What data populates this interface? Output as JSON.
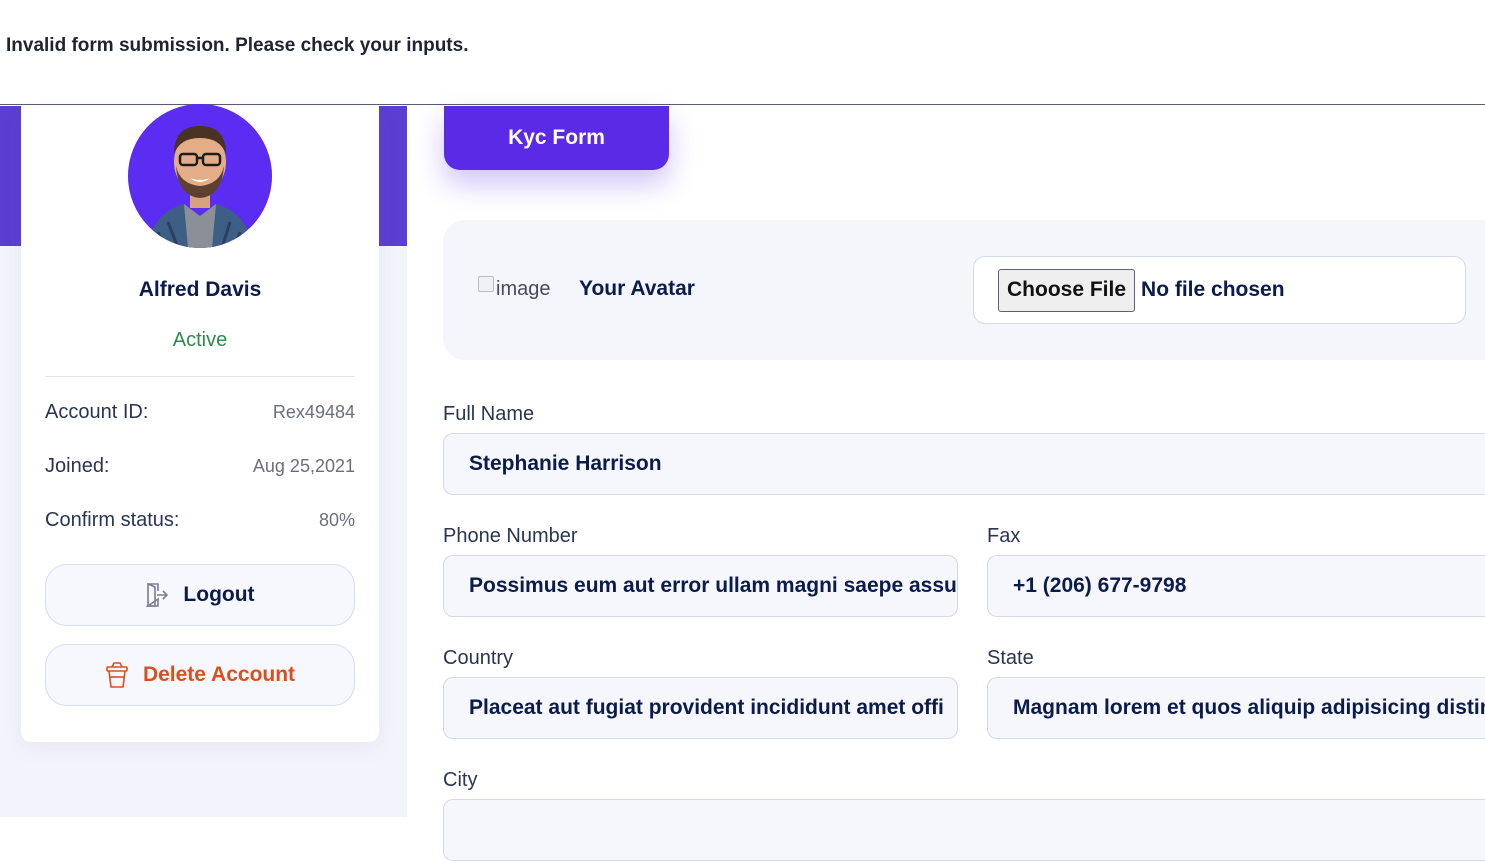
{
  "alert": {
    "message": "Invalid form submission. Please check your inputs."
  },
  "profile": {
    "name": "Alfred Davis",
    "status": "Active",
    "rows": [
      {
        "label": "Account ID:",
        "value": "Rex49484"
      },
      {
        "label": "Joined:",
        "value": "Aug 25,2021"
      },
      {
        "label": "Confirm status:",
        "value": "80%"
      }
    ],
    "logout_label": "Logout",
    "delete_label": "Delete Account"
  },
  "main": {
    "tab_label": "Kyc Form",
    "avatar": {
      "broken_image_alt": "image",
      "label": "Your Avatar",
      "choose_button": "Choose File",
      "file_status": "No file chosen"
    },
    "fields": {
      "full_name": {
        "label": "Full Name",
        "value": "Stephanie Harrison"
      },
      "phone": {
        "label": "Phone Number",
        "value": "Possimus eum aut error ullam magni saepe assu"
      },
      "fax": {
        "label": "Fax",
        "value": "+1 (206) 677-9798"
      },
      "country": {
        "label": "Country",
        "value": "Placeat aut fugiat provident incididunt amet offi"
      },
      "state": {
        "label": "State",
        "value": "Magnam lorem et quos aliquip adipisicing distin"
      },
      "city": {
        "label": "City",
        "value": ""
      }
    }
  },
  "colors": {
    "accent": "#5b2ae6",
    "status_active": "#2f8a4a",
    "danger": "#d9501e",
    "text_dark": "#0b1c4a"
  }
}
